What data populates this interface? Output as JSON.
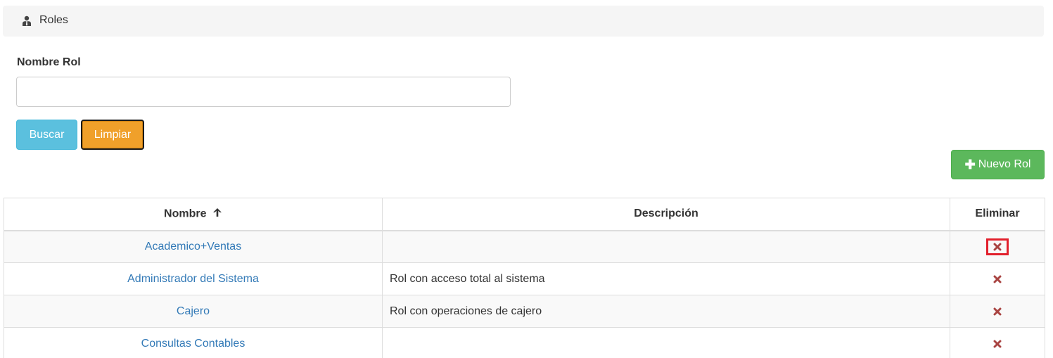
{
  "header": {
    "title": "Roles",
    "icon": "user-tie-icon"
  },
  "search": {
    "label": "Nombre Rol",
    "value": "",
    "placeholder": "",
    "buscar_label": "Buscar",
    "limpiar_label": "Limpiar"
  },
  "toolbar": {
    "nuevo_label": "Nuevo Rol"
  },
  "table": {
    "columns": {
      "nombre": "Nombre",
      "descripcion": "Descripción",
      "eliminar": "Eliminar"
    },
    "rows": [
      {
        "nombre": "Academico+Ventas",
        "descripcion": ""
      },
      {
        "nombre": "Administrador del Sistema",
        "descripcion": "Rol con acceso total al sistema"
      },
      {
        "nombre": "Cajero",
        "descripcion": "Rol con operaciones de cajero"
      },
      {
        "nombre": "Consultas Contables",
        "descripcion": ""
      }
    ]
  },
  "colors": {
    "accent_info": "#5bc0de",
    "accent_warning": "#f0ad4e",
    "accent_success": "#5cb85c",
    "link": "#337ab7",
    "delete": "#a94442"
  }
}
